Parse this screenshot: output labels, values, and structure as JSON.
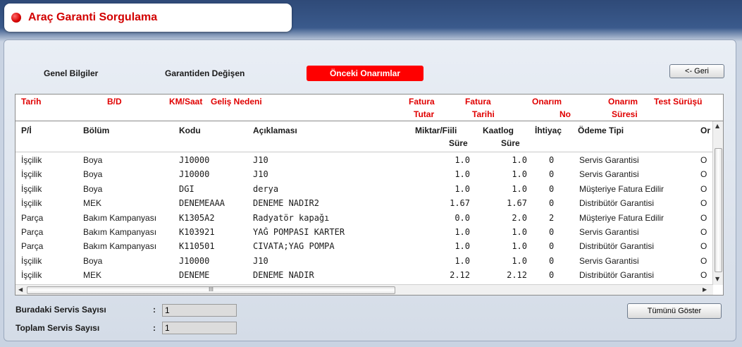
{
  "app": {
    "title": "Araç Garanti Sorgulama"
  },
  "toolbar": {
    "back_label": "<- Geri",
    "show_all_label": "Tümünü Göster"
  },
  "tabs": [
    {
      "label": "Genel Bilgiler",
      "active": false
    },
    {
      "label": "Garantiden Değişen",
      "active": false
    },
    {
      "label": "Önceki Onarımlar",
      "active": true
    }
  ],
  "outer_headers": {
    "tarih": "Tarih",
    "bd": "B/D",
    "km": "KM/Saat",
    "gelis": "Geliş Nedeni",
    "fatura_tutar_1": "Fatura",
    "fatura_tutar_2": "Tutar",
    "fatura_tarihi_1": "Fatura",
    "fatura_tarihi_2": "Tarihi",
    "onarim_no_1": "Onarım",
    "onarim_no_2": "No",
    "onarim_suresi_1": "Onarım",
    "onarim_suresi_2": "Süresi",
    "test": "Test Sürüşü"
  },
  "inner_headers": {
    "pi": "P/İ",
    "bolum": "Bölüm",
    "kodu": "Kodu",
    "aciklama": "Açıklaması",
    "miktar_1": "Miktar/Fiili",
    "miktar_2": "Süre",
    "kaatlog_1": "Kaatlog",
    "kaatlog_2": "Süre",
    "ihtiyac": "İhtiyaç",
    "odeme": "Ödeme Tipi",
    "last": "Or"
  },
  "rows": [
    {
      "pi": "İşçilik",
      "bolum": "Boya",
      "kodu": "J10000",
      "aciklama": "J10",
      "miktar": "1.0",
      "kaatlog": "1.0",
      "ihtiyac": "0",
      "odeme": "Servis Garantisi",
      "last": "O"
    },
    {
      "pi": "İşçilik",
      "bolum": "Boya",
      "kodu": "J10000",
      "aciklama": "J10",
      "miktar": "1.0",
      "kaatlog": "1.0",
      "ihtiyac": "0",
      "odeme": "Servis Garantisi",
      "last": "O"
    },
    {
      "pi": "İşçilik",
      "bolum": "Boya",
      "kodu": "DGI",
      "aciklama": "derya",
      "miktar": "1.0",
      "kaatlog": "1.0",
      "ihtiyac": "0",
      "odeme": "Müşteriye Fatura Edilir",
      "last": "O"
    },
    {
      "pi": "İşçilik",
      "bolum": "MEK",
      "kodu": "DENEMEAAA",
      "aciklama": "DENEME NADIR2",
      "miktar": "1.67",
      "kaatlog": "1.67",
      "ihtiyac": "0",
      "odeme": "Distribütör Garantisi",
      "last": "O"
    },
    {
      "pi": "Parça",
      "bolum": "Bakım Kampanyası",
      "kodu": "K1305A2",
      "aciklama": "Radyatör kapağı",
      "miktar": "0.0",
      "kaatlog": "2.0",
      "ihtiyac": "2",
      "odeme": "Müşteriye Fatura Edilir",
      "last": "O"
    },
    {
      "pi": "Parça",
      "bolum": "Bakım Kampanyası",
      "kodu": "K103921",
      "aciklama": "YAĞ POMPASI KARTER",
      "miktar": "1.0",
      "kaatlog": "1.0",
      "ihtiyac": "0",
      "odeme": "Servis Garantisi",
      "last": "O"
    },
    {
      "pi": "Parça",
      "bolum": "Bakım Kampanyası",
      "kodu": "K110501",
      "aciklama": "CIVATA;YAG POMPA",
      "miktar": "1.0",
      "kaatlog": "1.0",
      "ihtiyac": "0",
      "odeme": "Distribütör Garantisi",
      "last": "O"
    },
    {
      "pi": "İşçilik",
      "bolum": "Boya",
      "kodu": "J10000",
      "aciklama": "J10",
      "miktar": "1.0",
      "kaatlog": "1.0",
      "ihtiyac": "0",
      "odeme": "Servis Garantisi",
      "last": "O"
    },
    {
      "pi": "İşçilik",
      "bolum": "MEK",
      "kodu": "DENEME",
      "aciklama": "DENEME NADIR",
      "miktar": "2.12",
      "kaatlog": "2.12",
      "ihtiyac": "0",
      "odeme": "Distribütör Garantisi",
      "last": "O"
    }
  ],
  "footer": {
    "servis_label": "Buradaki Servis Sayısı",
    "servis_value": "1",
    "toplam_label": "Toplam Servis Sayısı",
    "toplam_value": "1",
    "colon": ":"
  },
  "scroll": {
    "hthumb_glyph": "III"
  },
  "colors": {
    "accent": "#ff0000",
    "header_red": "#e00000",
    "title_red": "#d20000"
  }
}
